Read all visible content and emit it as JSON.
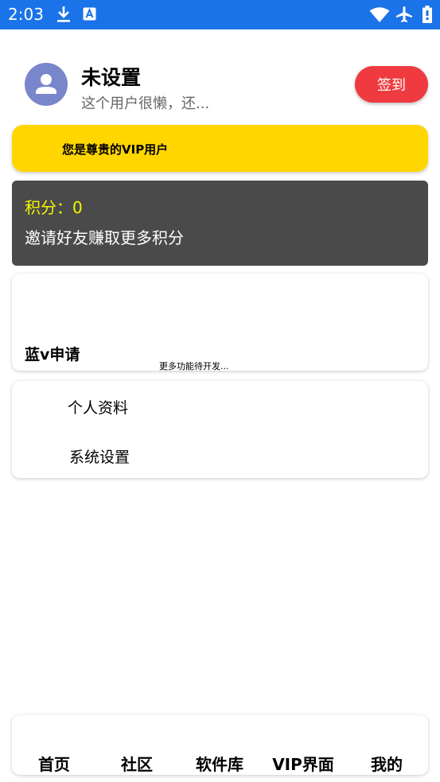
{
  "status_bar": {
    "time": "2:03",
    "icons_left": [
      "download-icon",
      "font-app-icon"
    ],
    "icons_right": [
      "wifi-icon",
      "airplane-mode-icon",
      "battery-icon"
    ],
    "background": "#1a73e8"
  },
  "profile": {
    "name": "未设置",
    "bio": "这个用户很懒，还...",
    "signin_label": "签到",
    "avatar_icon": "person-icon",
    "avatar_color": "#7986cb",
    "signin_color": "#ef3b3f"
  },
  "vip_banner": {
    "text": "您是尊贵的VIP用户",
    "color": "#ffd600"
  },
  "points_card": {
    "score": "积分：0",
    "invite": "邀请好友赚取更多积分",
    "score_color": "#f6f600",
    "background": "#4a4a4a"
  },
  "feature_card": {
    "blue_v": "蓝v申请",
    "more": "更多功能待开发..."
  },
  "settings_card": {
    "profile_item": "个人资料",
    "settings_item": "系统设置"
  },
  "bottom_nav": {
    "items": [
      {
        "label": "首页"
      },
      {
        "label": "社区"
      },
      {
        "label": "软件库"
      },
      {
        "label": "VIP界面"
      },
      {
        "label": "我的"
      }
    ]
  }
}
